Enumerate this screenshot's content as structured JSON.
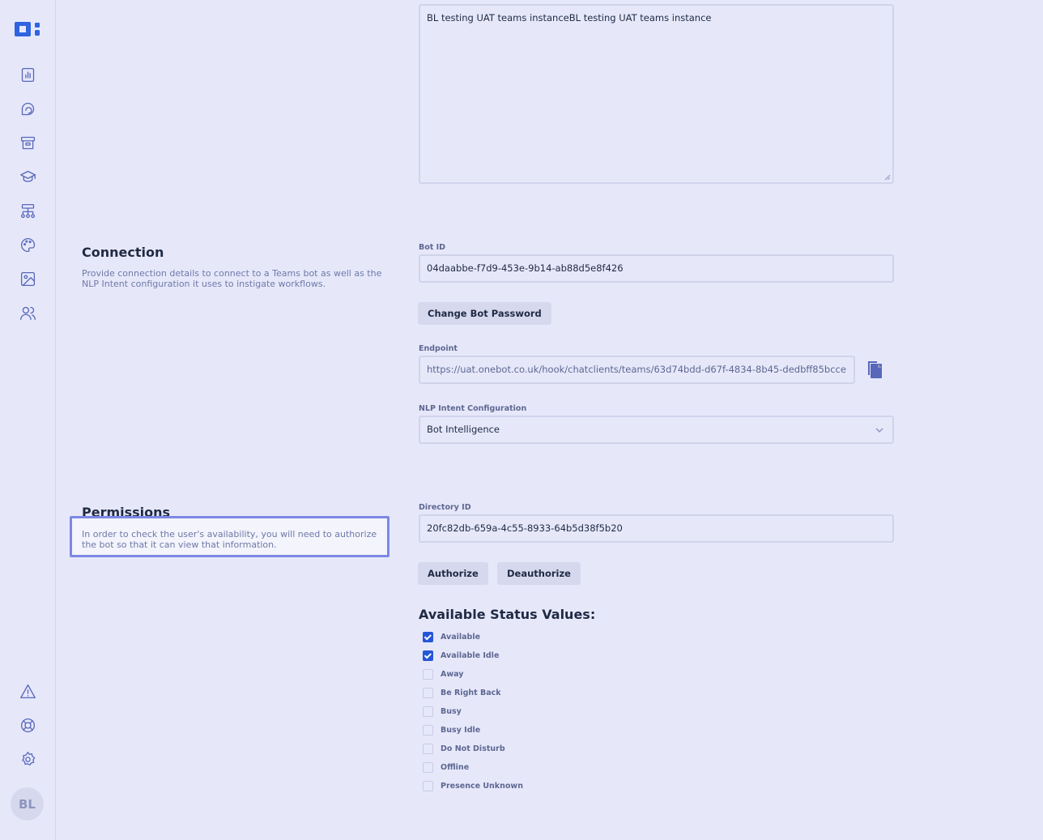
{
  "user": {
    "initials": "BL"
  },
  "description": {
    "value": "BL testing UAT teams instanceBL testing UAT teams instance"
  },
  "connection": {
    "title": "Connection",
    "description": "Provide connection details to connect to a Teams bot as well as the NLP Intent configuration it uses to instigate workflows.",
    "bot_id_label": "Bot ID",
    "bot_id_value": "04daabbe-f7d9-453e-9b14-ab88d5e8f426",
    "change_password_label": "Change Bot Password",
    "endpoint_label": "Endpoint",
    "endpoint_value": "https://uat.onebot.co.uk/hook/chatclients/teams/63d74bdd-d67f-4834-8b45-dedbff85bcce",
    "nlp_label": "NLP Intent Configuration",
    "nlp_value": "Bot Intelligence"
  },
  "permissions": {
    "title": "Permissions",
    "description": "In order to check the user's availability, you will need to authorize the bot so that it can view that information.",
    "directory_id_label": "Directory ID",
    "directory_id_value": "20fc82db-659a-4c55-8933-64b5d38f5b20",
    "authorize_label": "Authorize",
    "deauthorize_label": "Deauthorize",
    "status_heading": "Available Status Values:",
    "statuses": [
      {
        "label": "Available",
        "checked": true
      },
      {
        "label": "Available Idle",
        "checked": true
      },
      {
        "label": "Away",
        "checked": false
      },
      {
        "label": "Be Right Back",
        "checked": false
      },
      {
        "label": "Busy",
        "checked": false
      },
      {
        "label": "Busy Idle",
        "checked": false
      },
      {
        "label": "Do Not Disturb",
        "checked": false
      },
      {
        "label": "Offline",
        "checked": false
      },
      {
        "label": "Presence Unknown",
        "checked": false
      }
    ]
  },
  "icons": {
    "nav": [
      "chart-icon",
      "chat-icon",
      "archive-icon",
      "graduation-cap-icon",
      "workflow-icon",
      "palette-icon",
      "image-icon",
      "users-icon"
    ],
    "bottom": [
      "warning-icon",
      "help-icon",
      "gear-icon"
    ]
  },
  "colors": {
    "accent": "#2456d8",
    "background": "#e6e8fa",
    "icon": "#5867ba"
  }
}
